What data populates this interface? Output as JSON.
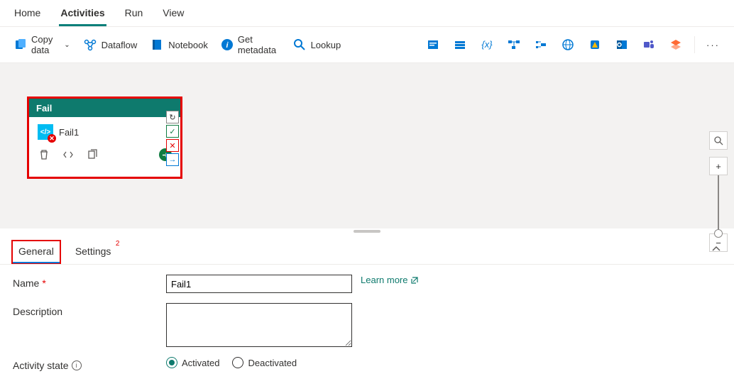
{
  "top_tabs": {
    "home": "Home",
    "activities": "Activities",
    "run": "Run",
    "view": "View"
  },
  "toolbar": {
    "copy_data": "Copy data",
    "dataflow": "Dataflow",
    "notebook": "Notebook",
    "get_metadata": "Get metadata",
    "lookup": "Lookup"
  },
  "activity": {
    "type": "Fail",
    "name": "Fail1"
  },
  "props": {
    "tab_general": "General",
    "tab_settings": "Settings",
    "settings_badge": "2",
    "name_label": "Name",
    "name_value": "Fail1",
    "desc_label": "Description",
    "desc_value": "",
    "state_label": "Activity state",
    "learn_more": "Learn more",
    "activated": "Activated",
    "deactivated": "Deactivated"
  }
}
